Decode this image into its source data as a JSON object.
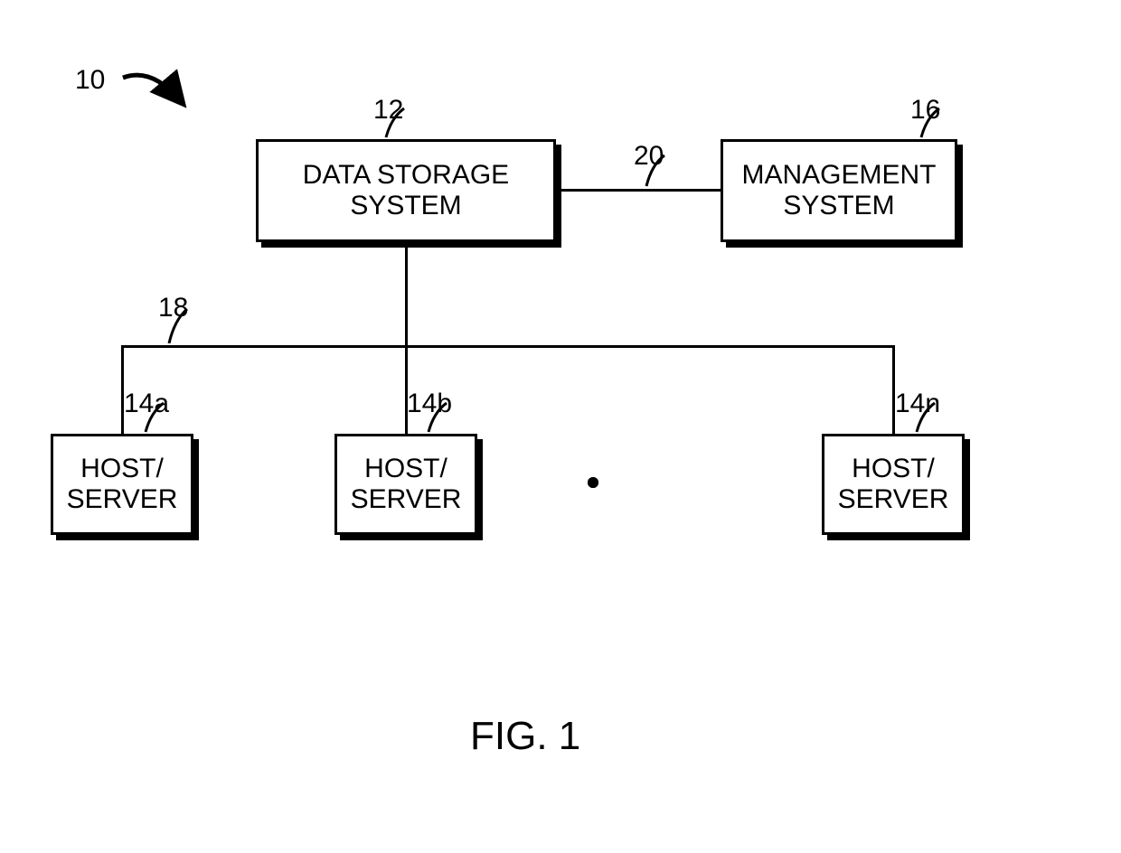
{
  "figure": {
    "system_label": "10",
    "title": "FIG. 1",
    "nodes": {
      "data_storage": {
        "label": "DATA STORAGE\nSYSTEM",
        "ref": "12"
      },
      "management": {
        "label": "MANAGEMENT\nSYSTEM",
        "ref": "16"
      },
      "host_a": {
        "label": "HOST/\nSERVER",
        "ref": "14a"
      },
      "host_b": {
        "label": "HOST/\nSERVER",
        "ref": "14b"
      },
      "host_n": {
        "label": "HOST/\nSERVER",
        "ref": "14n"
      }
    },
    "connections": {
      "hosts_bus": "18",
      "management_link": "20"
    }
  }
}
